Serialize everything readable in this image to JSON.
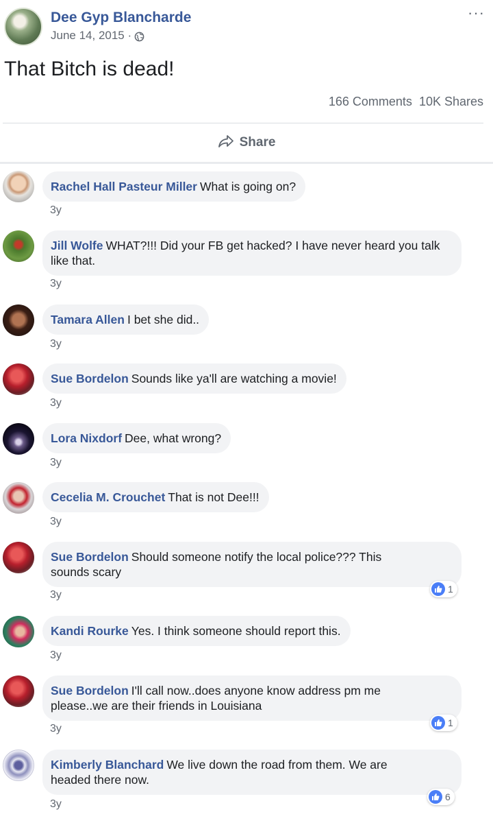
{
  "post": {
    "author": "Dee Gyp Blancharde",
    "date": "June 14, 2015 ·",
    "text": "That Bitch is dead!",
    "comments_count": "166 Comments",
    "shares_count": "10K Shares",
    "more_glyph": "···",
    "share_label": "Share"
  },
  "comments": [
    {
      "name": "Rachel Hall Pasteur Miller",
      "text": "What is going on?",
      "time": "3y"
    },
    {
      "name": "Jill Wolfe",
      "text": "WHAT?!!! Did your FB get hacked? I have never heard you talk like that.",
      "time": "3y"
    },
    {
      "name": "Tamara Allen",
      "text": "I bet she did..",
      "time": "3y"
    },
    {
      "name": "Sue Bordelon",
      "text": "Sounds like ya'll are watching a movie!",
      "time": "3y"
    },
    {
      "name": "Lora Nixdorf",
      "text": "Dee, what wrong?",
      "time": "3y"
    },
    {
      "name": "Cecelia M. Crouchet",
      "text": "That is not Dee!!!",
      "time": "3y"
    },
    {
      "name": "Sue Bordelon",
      "text": "Should someone notify the local police??? This sounds scary",
      "time": "3y",
      "likes": "1"
    },
    {
      "name": "Kandi Rourke",
      "text": "Yes. I think someone should report this.",
      "time": "3y"
    },
    {
      "name": "Sue Bordelon",
      "text": "I'll call now..does anyone know address pm me please..we are their friends in Louisiana",
      "time": "3y",
      "likes": "1"
    },
    {
      "name": "Kimberly Blanchard",
      "text": "We live down the road from them. We are headed there now.",
      "time": "3y",
      "likes": "6"
    }
  ],
  "icons": {
    "privacy": "globe-icon",
    "share": "share-arrow-icon",
    "like": "thumbs-up-icon",
    "more": "more-options-icon"
  },
  "colors": {
    "link_blue": "#385898",
    "bubble_bg": "#f2f3f5",
    "like_blue": "#4a7ef7",
    "meta_gray": "#616770"
  }
}
